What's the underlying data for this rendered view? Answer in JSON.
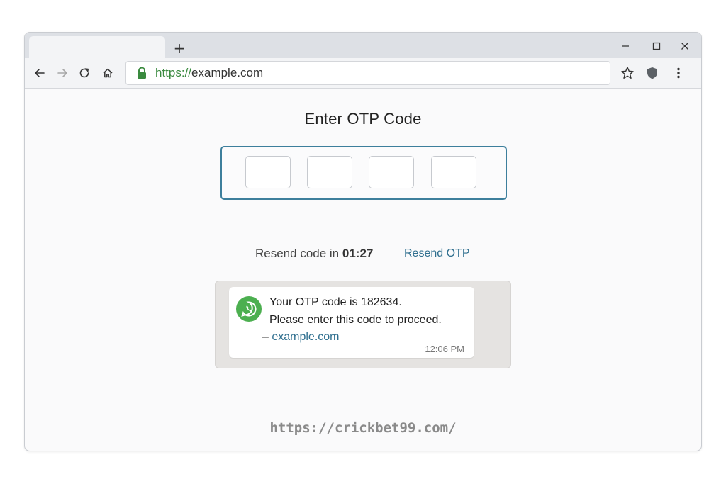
{
  "browser": {
    "new_tab_label": "+",
    "url_scheme": "https://",
    "url_host": "example.com",
    "colors": {
      "secure": "#3a8a3f",
      "tabstrip": "#dde0e5",
      "toolbar": "#f3f4f6"
    },
    "icons": [
      "back-icon",
      "forward-icon",
      "reload-icon",
      "home-icon",
      "lock-icon",
      "star-icon",
      "shield-icon",
      "menu-icon",
      "minimize-icon",
      "maximize-icon",
      "close-icon"
    ]
  },
  "page": {
    "title": "Enter OTP Code",
    "otp_digits": [
      "",
      "",
      "",
      ""
    ],
    "resend_prefix": "Resend code in ",
    "resend_timer": "01:27",
    "resend_link": "Resend OTP",
    "accent": "#3d7f9c",
    "link_color": "#2f6f8f"
  },
  "message": {
    "app_icon": "whatsapp-icon",
    "line1": "Your OTP code is 182634.",
    "line2": "Please enter this code to proceed.",
    "sign_prefix": "– ",
    "sign_link": "example.com",
    "time": "12:06 PM",
    "icon_color": "#4caf50"
  },
  "watermark": "https://crickbet99.com/"
}
